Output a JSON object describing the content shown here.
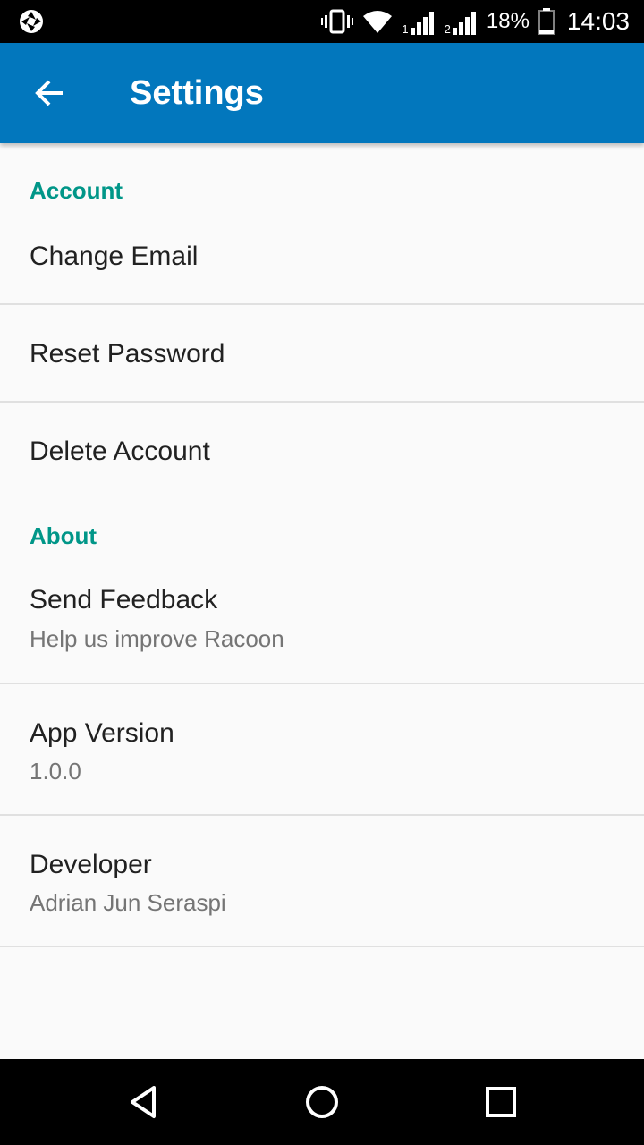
{
  "status_bar": {
    "battery": "18%",
    "time": "14:03",
    "sim1": "1",
    "sim2": "2"
  },
  "app_bar": {
    "title": "Settings",
    "back_icon": "arrow-back-icon",
    "color": "#0277bd"
  },
  "sections": [
    {
      "header": "Account",
      "items": [
        {
          "title": "Change Email"
        },
        {
          "title": "Reset Password"
        },
        {
          "title": "Delete Account"
        }
      ]
    },
    {
      "header": "About",
      "items": [
        {
          "title": "Send Feedback",
          "summary": "Help us improve Racoon"
        },
        {
          "title": "App Version",
          "summary": "1.0.0"
        },
        {
          "title": "Developer",
          "summary": "Adrian Jun Seraspi"
        }
      ]
    }
  ],
  "colors": {
    "accent": "#009688",
    "background": "#fafafa"
  },
  "nav_bar": {
    "icons": [
      "back-triangle-icon",
      "home-circle-icon",
      "recents-square-icon"
    ]
  }
}
